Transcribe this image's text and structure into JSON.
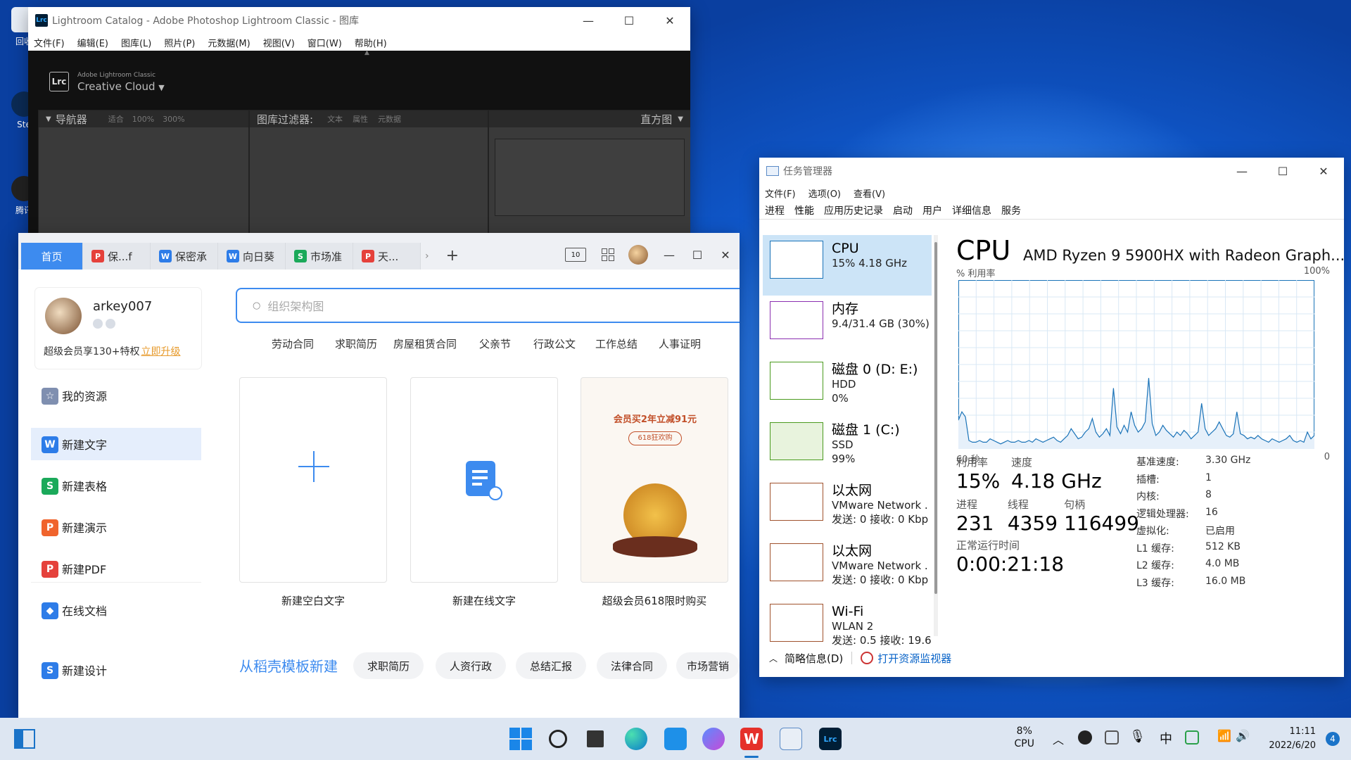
{
  "lightroom": {
    "title": "Lightroom Catalog - Adobe Photoshop Lightroom Classic - 图库",
    "menu": [
      "文件(F)",
      "编辑(E)",
      "图库(L)",
      "照片(P)",
      "元数据(M)",
      "视图(V)",
      "窗口(W)",
      "帮助(H)"
    ],
    "brand_small": "Adobe Lightroom Classic",
    "brand": "Creative Cloud",
    "navigator": "导航器",
    "nav_fit": "适合",
    "nav_100": "100%",
    "nav_300": "300%",
    "filter": "图库过滤器:",
    "filter_text": "文本",
    "filter_attr": "属性",
    "filter_meta": "元数据",
    "histogram": "直方图"
  },
  "taskmgr": {
    "title": "任务管理器",
    "menu": [
      "文件(F)",
      "选项(O)",
      "查看(V)"
    ],
    "tabs": [
      "进程",
      "性能",
      "应用历史记录",
      "启动",
      "用户",
      "详细信息",
      "服务"
    ],
    "items": [
      {
        "name": "CPU",
        "sub1": "15% 4.18 GHz",
        "sub2": "",
        "color": "#1a73b8"
      },
      {
        "name": "内存",
        "sub1": "9.4/31.4 GB (30%)",
        "sub2": "",
        "color": "#8b2fb0"
      },
      {
        "name": "磁盘 0 (D: E:)",
        "sub1": "HDD",
        "sub2": "0%",
        "color": "#4a9a1e"
      },
      {
        "name": "磁盘 1 (C:)",
        "sub1": "SSD",
        "sub2": "99%",
        "color": "#4a9a1e"
      },
      {
        "name": "以太网",
        "sub1": "VMware Network .",
        "sub2": "发送: 0 接收: 0 Kbp",
        "color": "#a0522d"
      },
      {
        "name": "以太网",
        "sub1": "VMware Network .",
        "sub2": "发送: 0 接收: 0 Kbp",
        "color": "#a0522d"
      },
      {
        "name": "Wi-Fi",
        "sub1": "WLAN 2",
        "sub2": "发送: 0.5 接收: 19.6",
        "color": "#a0522d"
      }
    ],
    "cpu_title": "CPU",
    "cpu_model": "AMD Ryzen 9 5900HX with Radeon Graph...",
    "graph_top_left": "% 利用率",
    "graph_top_right": "100%",
    "graph_bottom_left": "60 秒",
    "graph_bottom_right": "0",
    "util_label": "利用率",
    "util": "15%",
    "speed_label": "速度",
    "speed": "4.18 GHz",
    "proc_label": "进程",
    "proc": "231",
    "threads_label": "线程",
    "threads": "4359",
    "handles_label": "句柄",
    "handles": "116499",
    "uptime_label": "正常运行时间",
    "uptime": "0:00:21:18",
    "specs": [
      {
        "k": "基准速度:",
        "v": "3.30 GHz"
      },
      {
        "k": "插槽:",
        "v": "1"
      },
      {
        "k": "内核:",
        "v": "8"
      },
      {
        "k": "逻辑处理器:",
        "v": "16"
      },
      {
        "k": "虚拟化:",
        "v": "已启用"
      },
      {
        "k": "L1 缓存:",
        "v": "512 KB"
      },
      {
        "k": "L2 缓存:",
        "v": "4.0 MB"
      },
      {
        "k": "L3 缓存:",
        "v": "16.0 MB"
      }
    ],
    "footer_brief": "简略信息(D)",
    "footer_monitor": "打开资源监视器",
    "cpu_history": [
      0.17,
      0.22,
      0.19,
      0.05,
      0.04,
      0.04,
      0.05,
      0.04,
      0.04,
      0.06,
      0.05,
      0.04,
      0.03,
      0.04,
      0.05,
      0.04,
      0.04,
      0.05,
      0.04,
      0.04,
      0.05,
      0.04,
      0.06,
      0.05,
      0.04,
      0.05,
      0.06,
      0.07,
      0.05,
      0.04,
      0.06,
      0.08,
      0.12,
      0.09,
      0.06,
      0.07,
      0.1,
      0.12,
      0.18,
      0.1,
      0.07,
      0.09,
      0.12,
      0.08,
      0.36,
      0.13,
      0.09,
      0.14,
      0.1,
      0.22,
      0.14,
      0.1,
      0.12,
      0.16,
      0.42,
      0.15,
      0.08,
      0.1,
      0.14,
      0.11,
      0.09,
      0.07,
      0.1,
      0.08,
      0.11,
      0.09,
      0.06,
      0.08,
      0.1,
      0.27,
      0.12,
      0.08,
      0.1,
      0.12,
      0.16,
      0.12,
      0.08,
      0.07,
      0.09,
      0.22,
      0.09,
      0.08,
      0.06,
      0.07,
      0.06,
      0.08,
      0.06,
      0.05,
      0.04,
      0.06,
      0.05,
      0.04,
      0.05,
      0.06,
      0.08,
      0.05,
      0.04,
      0.05,
      0.04,
      0.1,
      0.06,
      0.08
    ]
  },
  "wps": {
    "tabs": [
      {
        "label": "首页",
        "badge": "",
        "color": ""
      },
      {
        "label": "保...f",
        "badge": "P",
        "color": "#e5413b"
      },
      {
        "label": "保密承",
        "badge": "W",
        "color": "#2d7ce8"
      },
      {
        "label": "向日葵",
        "badge": "W",
        "color": "#2d7ce8"
      },
      {
        "label": "市场准",
        "badge": "S",
        "color": "#1ba95a"
      },
      {
        "label": "天...",
        "badge": "P",
        "color": "#e5413b"
      }
    ],
    "username": "arkey007",
    "member_text": "超级会员享130+特权",
    "upgrade": "立即升级",
    "menu": [
      {
        "label": "我的资源",
        "color": "#7f8fb0",
        "glyph": "☆"
      },
      {
        "label": "新建文字",
        "color": "#2d7ce8",
        "glyph": "W"
      },
      {
        "label": "新建表格",
        "color": "#1ba95a",
        "glyph": "S"
      },
      {
        "label": "新建演示",
        "color": "#f0642d",
        "glyph": "P"
      },
      {
        "label": "新建PDF",
        "color": "#e5413b",
        "glyph": "P"
      },
      {
        "label": "在线文档",
        "color": "#2d7ce8",
        "glyph": "◆"
      },
      {
        "label": "新建设计",
        "color": "#2d7ce8",
        "glyph": "S"
      }
    ],
    "search_placeholder": "组织架构图",
    "keywords": [
      "劳动合同",
      "求职简历",
      "房屋租赁合同",
      "父亲节",
      "行政公文",
      "工作总结",
      "人事证明"
    ],
    "cards": [
      "新建空白文字",
      "新建在线文字",
      "超级会员618限时购买"
    ],
    "promo_title": "会员买2年立减91元",
    "promo_sub": "618狂欢购",
    "template_title": "从稻壳模板新建",
    "template_tags": [
      "求职简历",
      "人资行政",
      "总结汇报",
      "法律合同",
      "市场营销"
    ]
  },
  "taskbar": {
    "cpu_pct": "8%",
    "cpu_lbl": "CPU",
    "time": "11:11",
    "date": "2022/6/20",
    "notif": "4"
  }
}
